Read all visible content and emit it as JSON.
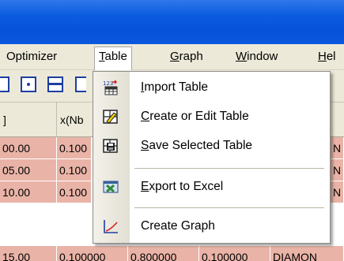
{
  "menu": {
    "items": [
      {
        "name": "optimizer",
        "label": "Optimizer",
        "key": "",
        "rest": ""
      },
      {
        "name": "table",
        "label": "",
        "key": "T",
        "rest": "able"
      },
      {
        "name": "graph",
        "label": "",
        "key": "G",
        "rest": "raph"
      },
      {
        "name": "window",
        "label": "",
        "key": "W",
        "rest": "indow"
      },
      {
        "name": "help",
        "label": "",
        "key": "H",
        "rest": "el"
      }
    ]
  },
  "grid": {
    "headers": [
      "]",
      "x(Nb"
    ],
    "rows": [
      [
        "00.00",
        "0.100",
        "N"
      ],
      [
        "05.00",
        "0.100",
        "N"
      ],
      [
        "10.00",
        "0.100",
        "N"
      ],
      [
        "15.00",
        "0.100000",
        "0.800000",
        "0.100000",
        "DIAMON"
      ]
    ]
  },
  "dropdown": {
    "items": [
      {
        "name": "import-table",
        "key": "I",
        "rest": "mport Table",
        "icon": "import-table-icon"
      },
      {
        "name": "create-edit-table",
        "key": "C",
        "rest": "reate or Edit Table",
        "icon": "edit-table-icon"
      },
      {
        "name": "save-selected-table",
        "key": "S",
        "rest": "ave Selected Table",
        "icon": "save-table-icon"
      },
      {
        "name": "export-excel",
        "key": "E",
        "rest": "xport to Excel",
        "icon": "excel-icon"
      },
      {
        "name": "create-graph",
        "key": "",
        "rest": "Create Graph",
        "icon": "graph-icon"
      }
    ]
  },
  "colors": {
    "title_blue": "#0b5ce0",
    "row_salmon": "#e9b4a7",
    "menu_bg": "#ece9d8"
  }
}
